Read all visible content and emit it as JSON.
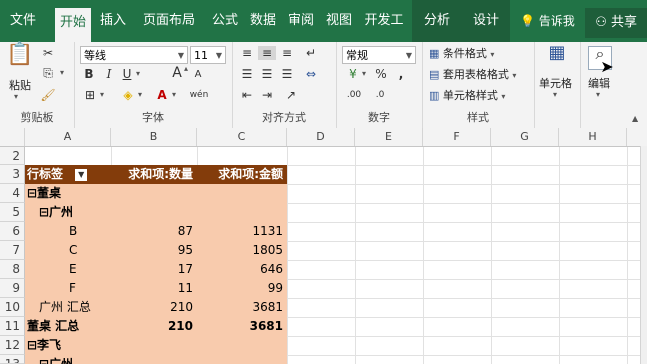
{
  "tabs": [
    "文件",
    "开始",
    "插入",
    "页面布局",
    "公式",
    "数据",
    "审阅",
    "视图",
    "开发工具",
    "分析",
    "设计"
  ],
  "tell_me": "告诉我",
  "share": "共享",
  "ribbon": {
    "clipboard": {
      "paste": "粘贴",
      "label": "剪贴板"
    },
    "font": {
      "name": "等线",
      "size": "11",
      "label": "字体",
      "bold": "B",
      "italic": "I",
      "underline": "U",
      "grow": "A",
      "shrink": "A",
      "phonetic": "wén"
    },
    "alignment": {
      "label": "对齐方式"
    },
    "number": {
      "format": "常规",
      "label": "数字"
    },
    "styles": {
      "conditional": "条件格式",
      "table": "套用表格格式",
      "cell": "单元格样式",
      "label": "样式"
    },
    "cells": {
      "label": "单元格"
    },
    "editing": {
      "label": "编辑"
    }
  },
  "columns": [
    "A",
    "B",
    "C",
    "D",
    "E",
    "F",
    "G",
    "H"
  ],
  "rows": [
    "2",
    "3",
    "4",
    "5",
    "6",
    "7",
    "8",
    "9",
    "10",
    "11",
    "12",
    "13"
  ],
  "pivot": {
    "header": {
      "a": "行标签",
      "b": "求和项:数量",
      "c": "求和项:金额"
    },
    "lines": [
      {
        "a": "⊟董桌",
        "b": "",
        "c": "",
        "bold": true,
        "indent": 0
      },
      {
        "a": "⊟广州",
        "b": "",
        "c": "",
        "bold": true,
        "indent": 1
      },
      {
        "a": "B",
        "b": "87",
        "c": "1131",
        "bold": false,
        "indent": 3
      },
      {
        "a": "C",
        "b": "95",
        "c": "1805",
        "bold": false,
        "indent": 3
      },
      {
        "a": "E",
        "b": "17",
        "c": "646",
        "bold": false,
        "indent": 3
      },
      {
        "a": "F",
        "b": "11",
        "c": "99",
        "bold": false,
        "indent": 3
      },
      {
        "a": "广州 汇总",
        "b": "210",
        "c": "3681",
        "bold": false,
        "indent": 1
      },
      {
        "a": "董桌 汇总",
        "b": "210",
        "c": "3681",
        "bold": true,
        "indent": 0
      },
      {
        "a": "⊟李飞",
        "b": "",
        "c": "",
        "bold": true,
        "indent": 0
      },
      {
        "a": "⊟广州",
        "b": "",
        "c": "",
        "bold": true,
        "indent": 1
      }
    ]
  },
  "colors": {
    "brand": "#217346",
    "pivot_header": "#833c0b",
    "pivot_body": "#f8cbad"
  }
}
